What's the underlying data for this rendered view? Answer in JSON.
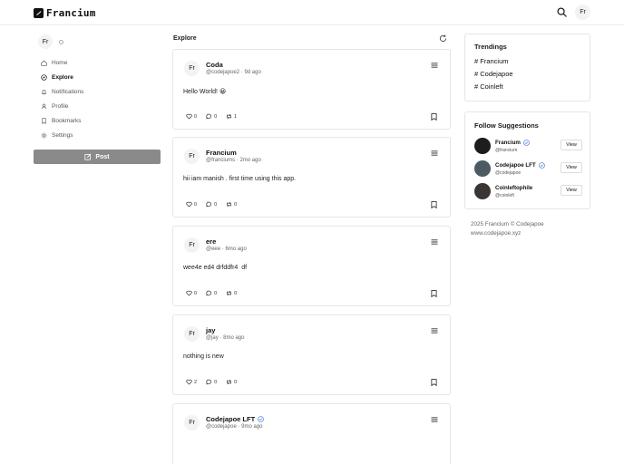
{
  "app": {
    "logo_text": "Francium",
    "avatar_initials": "Fr"
  },
  "sidebar": {
    "avatar_initials": "Fr",
    "items": [
      {
        "label": "Home",
        "icon": "home-icon"
      },
      {
        "label": "Explore",
        "icon": "compass-icon"
      },
      {
        "label": "Notifications",
        "icon": "bell-icon"
      },
      {
        "label": "Profile",
        "icon": "user-icon"
      },
      {
        "label": "Bookmarks",
        "icon": "bookmark-icon"
      },
      {
        "label": "Settings",
        "icon": "gear-icon"
      }
    ],
    "post_label": "Post"
  },
  "feed": {
    "title": "Explore",
    "posts": [
      {
        "initials": "Fr",
        "name": "Coda",
        "handle": "@codejapoe2",
        "time": "9d ago",
        "body": "Hello World! 😀",
        "likes": "0",
        "comments": "0",
        "reposts": "1",
        "verified": false
      },
      {
        "initials": "Fr",
        "name": "Francium",
        "handle": "@franciums",
        "time": "2mo ago",
        "body": "hii iam manish . first time using this app.",
        "likes": "0",
        "comments": "0",
        "reposts": "0",
        "verified": false
      },
      {
        "initials": "Fr",
        "name": "ere",
        "handle": "@eee",
        "time": "6mo ago",
        "body": "wee4e ed4 drfddfr4  df",
        "likes": "0",
        "comments": "0",
        "reposts": "0",
        "verified": false
      },
      {
        "initials": "Fr",
        "name": "jay",
        "handle": "@jay",
        "time": "8mo ago",
        "body": "nothing is new",
        "likes": "2",
        "comments": "0",
        "reposts": "0",
        "verified": false
      },
      {
        "initials": "Fr",
        "name": "Codejapoe LFT",
        "handle": "@codejapoe",
        "time": "9mo ago",
        "body": "",
        "likes": "",
        "comments": "",
        "reposts": "",
        "verified": true
      }
    ]
  },
  "trendings": {
    "title": "Trendings",
    "items": [
      "# Francium",
      "# Codejapoe",
      "# Coinleft"
    ]
  },
  "suggestions": {
    "title": "Follow Suggestions",
    "view_label": "View",
    "items": [
      {
        "name": "Francium",
        "handle": "@francium",
        "verified": true,
        "avatar_color": "#1d1d1d"
      },
      {
        "name": "Codejapoe LFT",
        "handle": "@codejapoe",
        "verified": true,
        "avatar_color": "#4d5a63"
      },
      {
        "name": "Coinleftophile",
        "handle": "@coinleft",
        "verified": false,
        "avatar_color": "#3a3532"
      }
    ]
  },
  "footer": {
    "line1": "2025 Francium © Codejapoe",
    "line2": "www.codejapoe.xyz"
  },
  "colors": {
    "post_button": "#8a8a8a",
    "verified": "#4a7fd8"
  }
}
